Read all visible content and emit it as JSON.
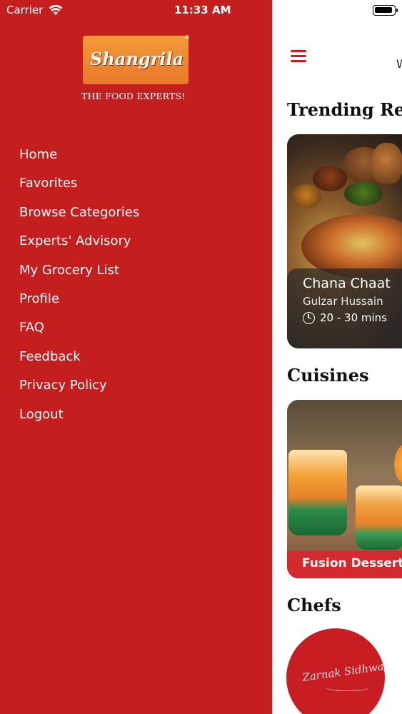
{
  "status_bar": {
    "carrier": "Carrier",
    "time": "11:33 AM"
  },
  "drawer": {
    "background_color": "#c41e1e",
    "logo": {
      "brand": "Shangrila",
      "registered": "®",
      "tagline": "THE FOOD EXPERTS!"
    },
    "menu_items": [
      {
        "label": "Home"
      },
      {
        "label": "Favorites"
      },
      {
        "label": "Browse Categories"
      },
      {
        "label": "Experts' Advisory"
      },
      {
        "label": "My Grocery List"
      },
      {
        "label": "Profile"
      },
      {
        "label": "FAQ"
      },
      {
        "label": "Feedback"
      },
      {
        "label": "Privacy Policy"
      },
      {
        "label": "Logout"
      }
    ]
  },
  "main": {
    "accent_color": "#c81e23",
    "header_partial_text": "W",
    "trending": {
      "title": "Trending Reci",
      "card": {
        "name": "Chana Chaat",
        "author": "Gulzar Hussain",
        "time": "20 - 30 mins"
      }
    },
    "cuisines": {
      "title": "Cuisines",
      "card": {
        "label": "Fusion Dessert"
      }
    },
    "chefs": {
      "title": "Chefs",
      "chef": {
        "signature": "Zarnak Sidhwa"
      }
    }
  }
}
